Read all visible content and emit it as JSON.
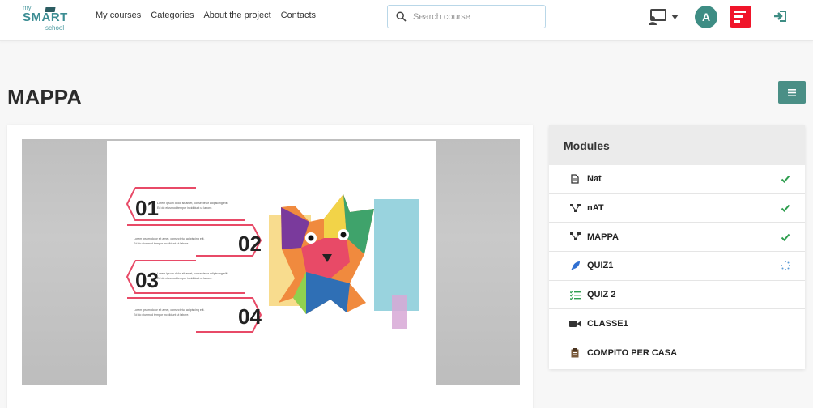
{
  "brand": {
    "my": "my",
    "smart": "SMART",
    "school": "school"
  },
  "nav": {
    "links": [
      "My courses",
      "Categories",
      "About the project",
      "Contacts"
    ]
  },
  "search": {
    "placeholder": "Search course",
    "value": ""
  },
  "user": {
    "avatar_letter": "A"
  },
  "page": {
    "title": "MAPPA"
  },
  "slide": {
    "numbers": [
      "01",
      "02",
      "03",
      "04"
    ],
    "item_text_line1": "Lorem ipsum dolor sit amet, consectetur adipiscing elit.",
    "item_text_line2": "Ed do eiusmod tempor incididunt ut labore."
  },
  "modules": {
    "heading": "Modules",
    "items": [
      {
        "label": "Nat",
        "icon": "document-icon",
        "status": "completed"
      },
      {
        "label": "nAT",
        "icon": "mindmap-icon",
        "status": "completed"
      },
      {
        "label": "MAPPA",
        "icon": "mindmap-icon",
        "status": "completed"
      },
      {
        "label": "QUIZ1",
        "icon": "rocket-icon",
        "status": "in-progress"
      },
      {
        "label": "QUIZ 2",
        "icon": "checklist-icon",
        "status": "none"
      },
      {
        "label": "CLASSE1",
        "icon": "video-camera-icon",
        "status": "none"
      },
      {
        "label": "COMPITO PER CASA",
        "icon": "clipboard-icon",
        "status": "none"
      }
    ]
  },
  "colors": {
    "accent": "#4a8f86",
    "check": "#2e9e4f",
    "app_red": "#f0152a",
    "logo": "#3c8d93"
  }
}
